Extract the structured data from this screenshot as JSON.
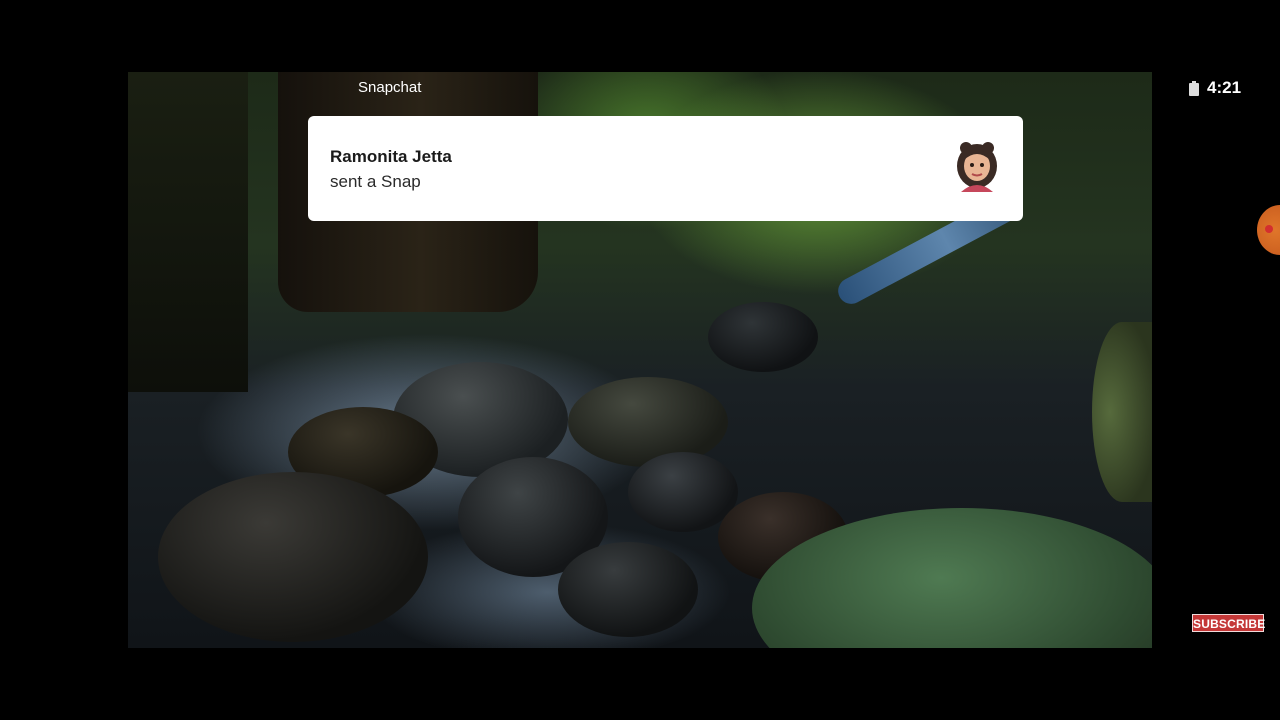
{
  "notification": {
    "app_name": "Snapchat",
    "sender": "Ramonita Jetta",
    "message": "sent a Snap",
    "avatar_icon": "bitmoji-avatar-icon"
  },
  "status_bar": {
    "time": "4:21",
    "battery_icon": "battery-icon"
  },
  "overlay": {
    "subscribe_label": "SUBSCRIBE",
    "side_bubble_icon": "floating-bubble-icon"
  },
  "colors": {
    "background": "#000000",
    "card": "#ffffff",
    "subscribe": "#c43737"
  }
}
